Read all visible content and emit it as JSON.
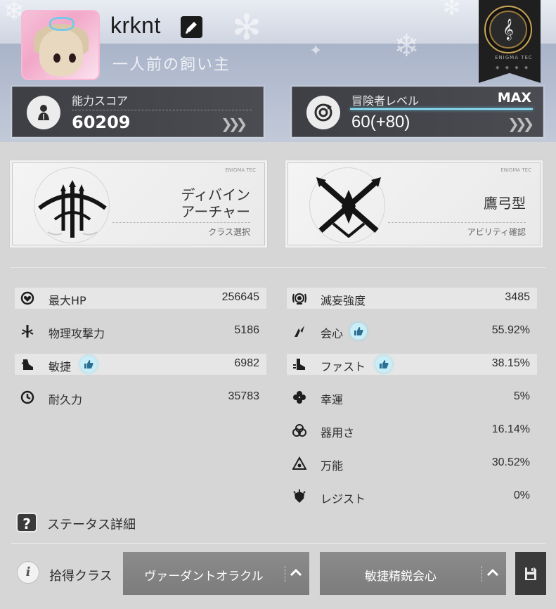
{
  "profile": {
    "username": "krknt",
    "title": "一人前の飼い主"
  },
  "rank_badge": {
    "brand": "ENIGMA TEC",
    "dots": "◆ ◆ ◆ ◆"
  },
  "ability_score": {
    "label": "能力スコア",
    "value": "60209"
  },
  "adventurer_level": {
    "label": "冒険者レベル",
    "value": "60(+80)",
    "max_tag": "MAX"
  },
  "class_card": {
    "brand": "ENIGMA TEC",
    "title_line1": "ディバイン",
    "title_line2": "アーチャー",
    "link": "クラス選択"
  },
  "ability_card": {
    "brand": "ENIGMA TEC",
    "title": "鷹弓型",
    "link": "アビリティ確認"
  },
  "stats_left": [
    {
      "name": "最大HP",
      "value": "256645",
      "icon": "heart-shield-icon"
    },
    {
      "name": "物理攻撃力",
      "value": "5186",
      "icon": "sword-burst-icon"
    },
    {
      "name": "敏捷",
      "value": "6982",
      "icon": "boot-wing-icon",
      "recommended": true
    },
    {
      "name": "耐久力",
      "value": "35783",
      "icon": "shield-clock-icon"
    }
  ],
  "stats_right": [
    {
      "name": "滅妄強度",
      "value": "3485",
      "icon": "radiating-eye-icon"
    },
    {
      "name": "会心",
      "value": "55.92%",
      "icon": "claw-strike-icon",
      "recommended": true
    },
    {
      "name": "ファスト",
      "value": "38.15%",
      "icon": "fast-boot-icon",
      "recommended": true
    },
    {
      "name": "幸運",
      "value": "5%",
      "icon": "clover-icon"
    },
    {
      "name": "器用さ",
      "value": "16.14%",
      "icon": "triple-rings-icon"
    },
    {
      "name": "万能",
      "value": "30.52%",
      "icon": "warning-triangle-icon"
    },
    {
      "name": "レジスト",
      "value": "0%",
      "icon": "spiked-shield-icon"
    }
  ],
  "status_detail": {
    "icon_glyph": "?",
    "label": "ステータス詳細"
  },
  "footer": {
    "info_glyph": "i",
    "loot_label": "拾得クラス",
    "class_select": "ヴァーダントオラクル",
    "preset_select": "敏捷精鋭会心"
  },
  "colors": {
    "panel_dark": "#3e3f44",
    "level_bar": "#8ee9ff",
    "recommend_badge": "#c9eef8",
    "dropdown_bg": "#8b8b8b"
  }
}
